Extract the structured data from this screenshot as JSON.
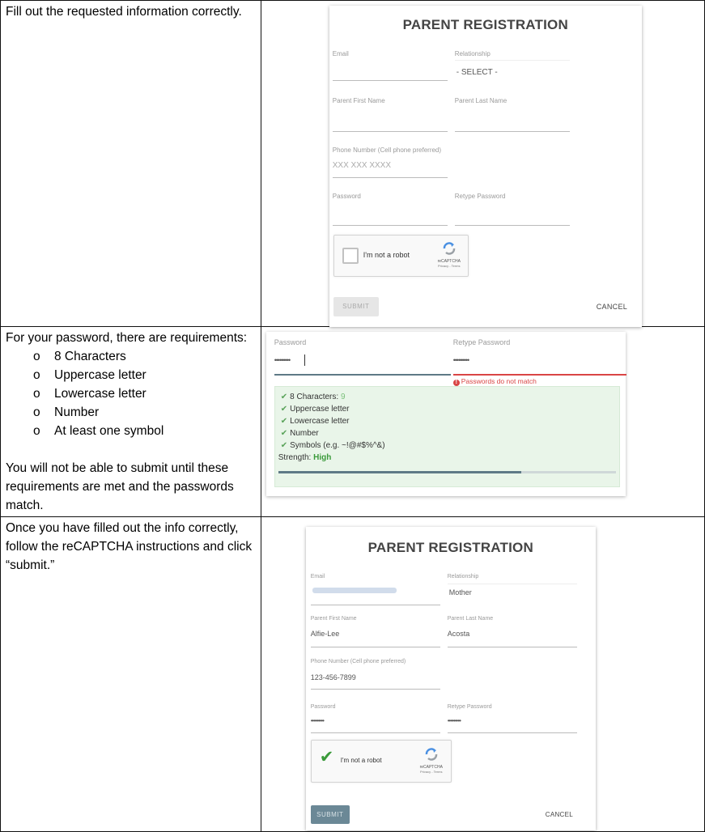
{
  "row1": {
    "instruction": "Fill out the requested information correctly.",
    "form": {
      "title": "PARENT REGISTRATION",
      "email_label": "Email",
      "relationship_label": "Relationship",
      "relationship_value": "- SELECT -",
      "first_name_label": "Parent First Name",
      "last_name_label": "Parent Last Name",
      "phone_label": "Phone Number (Cell phone preferred)",
      "phone_placeholder": "XXX XXX XXXX",
      "password_label": "Password",
      "retype_label": "Retype Password",
      "captcha_label": "I'm not a robot",
      "captcha_brand": "reCAPTCHA",
      "captcha_sub": "Privacy - Terms",
      "submit_label": "SUBMIT",
      "cancel_label": "CANCEL"
    }
  },
  "row2": {
    "intro": "For your password, there are requirements:",
    "requirements": [
      "8 Characters",
      "Uppercase letter",
      "Lowercase letter",
      "Number",
      "At least one symbol"
    ],
    "note": "You will not be able to submit until these requirements are met and the passwords match.",
    "panel": {
      "password_label": "Password",
      "password_value": "•••••••••",
      "retype_label": "Retype Password",
      "retype_value": "•••••••••",
      "error": "Passwords do not match",
      "check_items": [
        "8 Characters: ",
        "Uppercase letter",
        "Lowercase letter",
        "Number",
        "Symbols (e.g. ~!@#$%^&)"
      ],
      "char_count": "9",
      "strength_label": "Strength: ",
      "strength_value": "High",
      "strength_fraction": 0.72
    }
  },
  "row3": {
    "instruction": "Once you have filled out the info correctly, follow the reCAPTCHA instructions and click “submit.”",
    "form": {
      "title": "PARENT REGISTRATION",
      "email_label": "Email",
      "relationship_label": "Relationship",
      "relationship_value": "Mother",
      "first_name_label": "Parent First Name",
      "first_name_value": "Alfie-Lee",
      "last_name_label": "Parent Last Name",
      "last_name_value": "Acosta",
      "phone_label": "Phone Number (Cell phone preferred)",
      "phone_value": "123-456-7899",
      "password_label": "Password",
      "password_value": "•••••••••",
      "retype_label": "Retype Password",
      "retype_value": "•••••••••",
      "captcha_label": "I'm not a robot",
      "captcha_brand": "reCAPTCHA",
      "captcha_sub": "Privacy - Terms",
      "submit_label": "SUBMIT",
      "cancel_label": "CANCEL"
    }
  },
  "colors": {
    "strength_green": "#3a9a3a",
    "error_red": "#d94545",
    "submit_active": "#6b8896",
    "submit_disabled": "#e6e6e6",
    "check_green": "#5aa35a"
  }
}
